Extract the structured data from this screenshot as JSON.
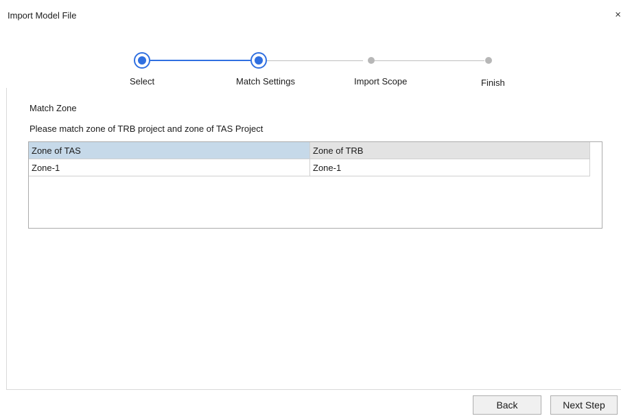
{
  "dialog": {
    "title": "Import Model File",
    "close_glyph": "×"
  },
  "stepper": {
    "steps": [
      {
        "label": "Select",
        "state": "completed"
      },
      {
        "label": "Match Settings",
        "state": "active"
      },
      {
        "label": "Import Scope",
        "state": "pending"
      },
      {
        "label": "Finish",
        "state": "pending"
      }
    ],
    "active_color": "#2f6fe0",
    "inactive_color": "#b7b7b7"
  },
  "content": {
    "section_title": "Match Zone",
    "instruction": "Please match zone of TRB project and zone of TAS Project",
    "table": {
      "columns": [
        "Zone of TAS",
        "Zone of TRB"
      ],
      "rows": [
        [
          "Zone-1",
          "Zone-1"
        ]
      ]
    }
  },
  "footer": {
    "back_label": "Back",
    "next_label": "Next Step"
  }
}
